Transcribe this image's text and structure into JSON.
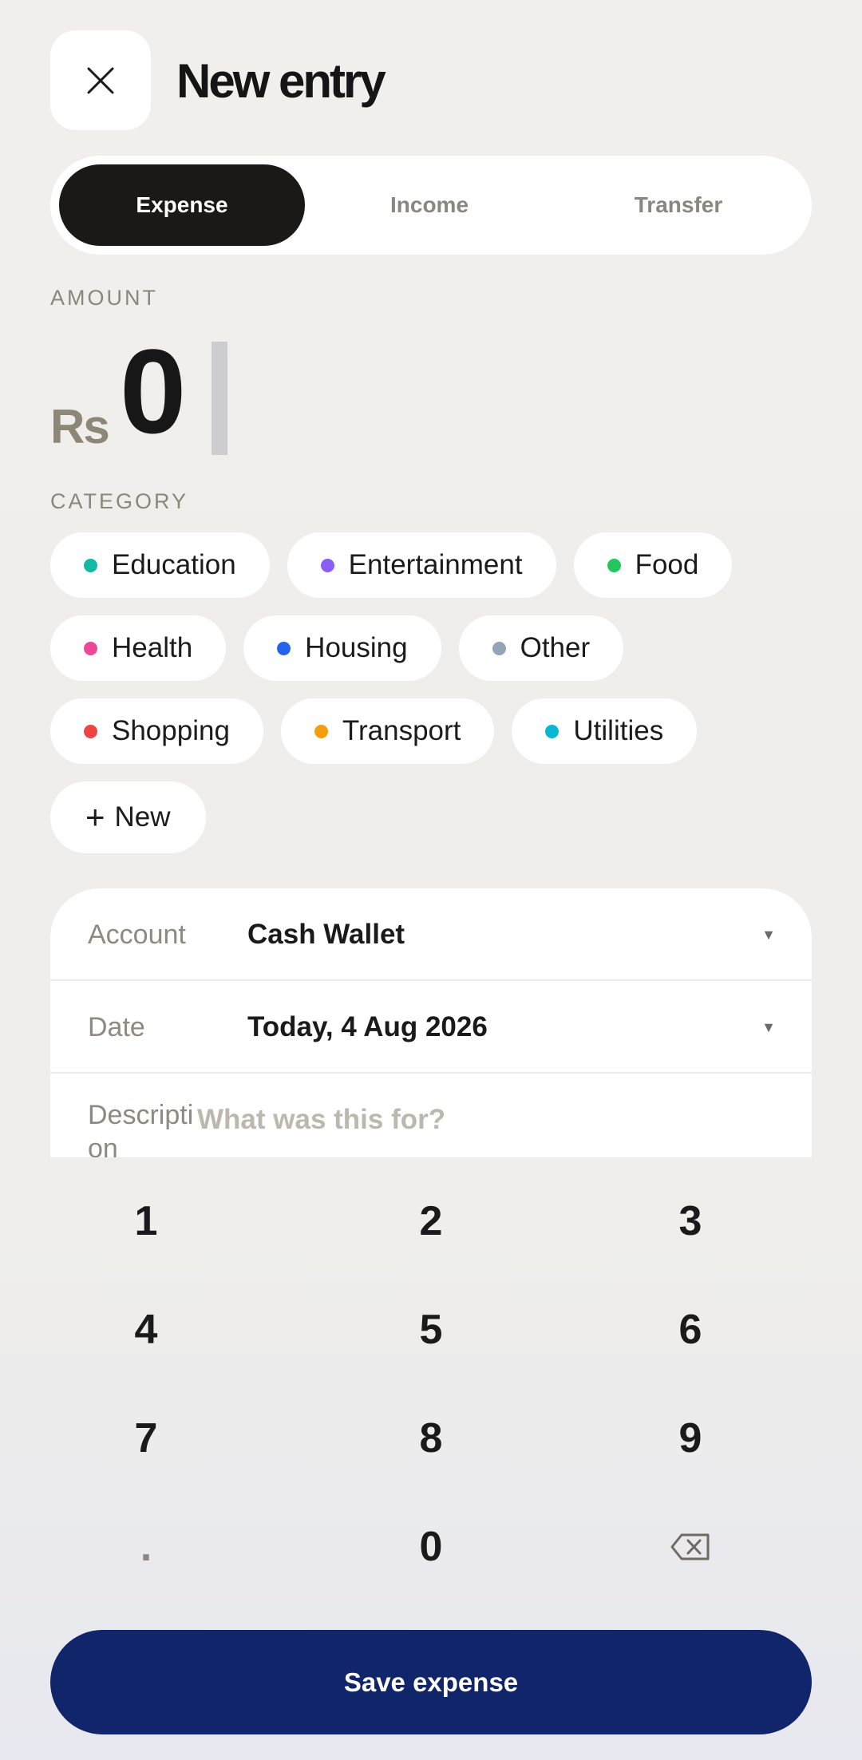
{
  "header": {
    "title": "New entry",
    "close_icon": "close-icon"
  },
  "tabs": [
    {
      "label": "Expense",
      "active": true
    },
    {
      "label": "Income",
      "active": false
    },
    {
      "label": "Transfer",
      "active": false
    }
  ],
  "amount": {
    "label": "AMOUNT",
    "currency": "Rs",
    "value": "0"
  },
  "category": {
    "label": "CATEGORY",
    "items": [
      {
        "label": "Education",
        "color": "#14b8a6"
      },
      {
        "label": "Entertainment",
        "color": "#8b5cf6"
      },
      {
        "label": "Food",
        "color": "#22c55e"
      },
      {
        "label": "Health",
        "color": "#ec4899"
      },
      {
        "label": "Housing",
        "color": "#2563eb"
      },
      {
        "label": "Other",
        "color": "#94a3b8"
      },
      {
        "label": "Shopping",
        "color": "#ef4444"
      },
      {
        "label": "Transport",
        "color": "#f59e0b"
      },
      {
        "label": "Utilities",
        "color": "#06b6d4"
      }
    ],
    "new_label": "New"
  },
  "form": {
    "account_label": "Account",
    "account_value": "Cash Wallet",
    "date_label": "Date",
    "date_value": "Today, 4 Aug 2026",
    "description_label": "Descripti on",
    "description_placeholder": "What was this for?",
    "description_value": ""
  },
  "keypad": [
    "1",
    "2",
    "3",
    "4",
    "5",
    "6",
    "7",
    "8",
    "9",
    ".",
    "0",
    "⌫"
  ],
  "save_label": "Save expense",
  "colors": {
    "accent": "#11256a",
    "active_tab": "#1a1917",
    "background": "#efeeea"
  }
}
